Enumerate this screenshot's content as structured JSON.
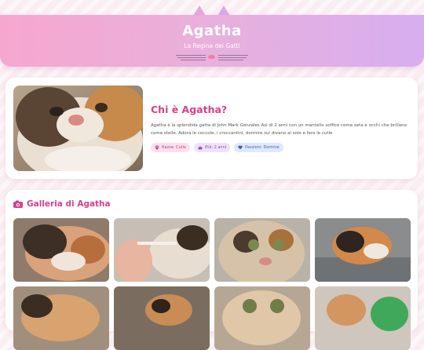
{
  "header": {
    "title": "Agatha",
    "subtitle": "La Regina dei Gatti"
  },
  "about": {
    "title": "Chi è Agatha?",
    "text": "Agatha è la splendida gatta di John Mark Gonzales Asi di 2 anni con un mantello soffice come seta e occhi che brillano come stelle. Adora le coccole, i croccantini, dormire sul divano al sole e fare le cutie",
    "tags": [
      {
        "icon": "paw-icon",
        "label": "Razza: Cutie"
      },
      {
        "icon": "cake-icon",
        "label": "Età: 2 anni"
      },
      {
        "icon": "heart-icon",
        "label": "Passioni: Dormire"
      }
    ]
  },
  "gallery": {
    "title": "Galleria di Agatha",
    "icon": "camera-icon"
  },
  "colors": {
    "accent": "#d93f8c",
    "header_start": "#f6a7cf",
    "header_end": "#d7aef0"
  }
}
